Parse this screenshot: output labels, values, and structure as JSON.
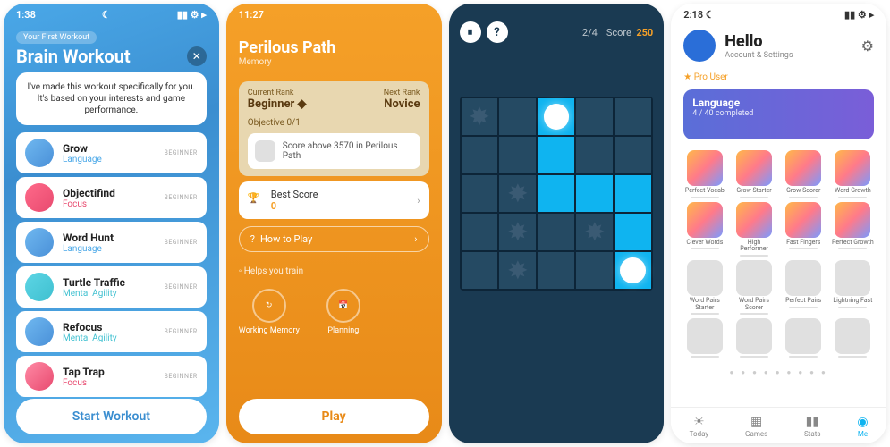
{
  "p1": {
    "status_time": "1:38",
    "tag": "Your First Workout",
    "title": "Brain Workout",
    "intro": "I've made this workout specifically for you. It's based on your interests and game performance.",
    "items": [
      {
        "title": "Grow",
        "cat": "Language",
        "cat_class": "cat-lang",
        "ico": "ico-blue",
        "badge": "BEGINNER"
      },
      {
        "title": "Objectifind",
        "cat": "Focus",
        "cat_class": "cat-focus",
        "ico": "ico-red",
        "badge": "BEGINNER"
      },
      {
        "title": "Word Hunt",
        "cat": "Language",
        "cat_class": "cat-lang",
        "ico": "ico-blue",
        "badge": "BEGINNER"
      },
      {
        "title": "Turtle Traffic",
        "cat": "Mental Agility",
        "cat_class": "cat-mental",
        "ico": "ico-teal",
        "badge": "BEGINNER"
      },
      {
        "title": "Refocus",
        "cat": "Mental Agility",
        "cat_class": "cat-mental",
        "ico": "ico-blue",
        "badge": "BEGINNER"
      },
      {
        "title": "Tap Trap",
        "cat": "Focus",
        "cat_class": "cat-focus",
        "ico": "ico-pink",
        "badge": "BEGINNER"
      }
    ],
    "start": "Start Workout"
  },
  "p2": {
    "status_time": "11:27",
    "title": "Perilous Path",
    "sub": "Memory",
    "cur_rank_label": "Current Rank",
    "cur_rank": "Beginner",
    "next_rank_label": "Next Rank",
    "next_rank": "Novice",
    "obj_label": "Objective",
    "obj_count": "0/1",
    "obj_text": "Score above 3570 in Perilous Path",
    "best_label": "Best Score",
    "best_val": "0",
    "howto": "How to Play",
    "helps": "Helps you train",
    "train": [
      "Working Memory",
      "Planning"
    ],
    "play": "Play"
  },
  "p3": {
    "progress": "2/4",
    "score_label": "Score",
    "score": "250"
  },
  "p4": {
    "status_time": "2:18",
    "title": "Hello",
    "sub": "Account & Settings",
    "pro": "Pro User",
    "banner_title": "Language",
    "banner_sub": "4 / 40 completed",
    "ach": [
      {
        "label": "Perfect Vocab",
        "c": "colorful"
      },
      {
        "label": "Grow Starter",
        "c": "colorful"
      },
      {
        "label": "Grow Scorer",
        "c": "colorful"
      },
      {
        "label": "Word Growth",
        "c": "colorful"
      },
      {
        "label": "Clever Words",
        "c": "colorful"
      },
      {
        "label": "High Performer",
        "c": "colorful"
      },
      {
        "label": "Fast Fingers",
        "c": "colorful"
      },
      {
        "label": "Perfect Growth",
        "c": "colorful"
      },
      {
        "label": "Word Pairs Starter",
        "c": "grey"
      },
      {
        "label": "Word Pairs Scorer",
        "c": "grey"
      },
      {
        "label": "Perfect Pairs",
        "c": "grey"
      },
      {
        "label": "Lightning Fast",
        "c": "grey"
      },
      {
        "label": "",
        "c": "grey"
      },
      {
        "label": "",
        "c": "grey"
      },
      {
        "label": "",
        "c": "grey"
      },
      {
        "label": "",
        "c": "grey"
      }
    ],
    "nav": [
      {
        "label": "Today",
        "ico": "☀"
      },
      {
        "label": "Games",
        "ico": "▦"
      },
      {
        "label": "Stats",
        "ico": "▮▮"
      },
      {
        "label": "Me",
        "ico": "◉"
      }
    ]
  }
}
